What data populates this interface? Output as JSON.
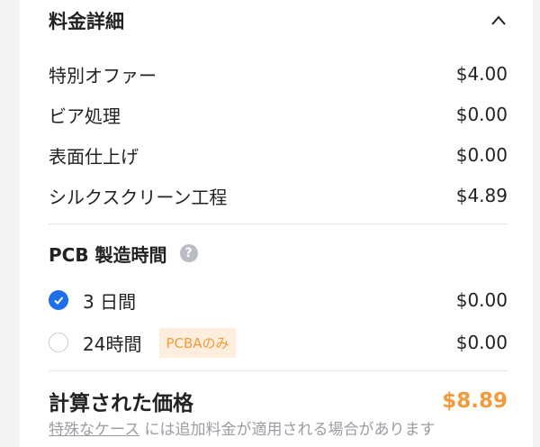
{
  "section": {
    "title": "料金詳細",
    "collapse_icon": "chevron-up-icon"
  },
  "line_items": [
    {
      "label": "特別オファー",
      "price": "$4.00"
    },
    {
      "label": "ビア処理",
      "price": "$0.00"
    },
    {
      "label": "表面仕上げ",
      "price": "$0.00"
    },
    {
      "label": "シルクスクリーン工程",
      "price": "$4.89"
    }
  ],
  "build_time": {
    "title": "PCB 製造時間",
    "help_icon": "question-circle-icon",
    "help_glyph": "?",
    "options": [
      {
        "label": "3 日間",
        "price": "$0.00",
        "selected": true
      },
      {
        "label": "24時間",
        "tag": "PCBAのみ",
        "price": "$0.00",
        "selected": false
      }
    ]
  },
  "total": {
    "label": "計算された価格",
    "price": "$8.89"
  },
  "note": {
    "link": "特殊なケース",
    "text": " には追加料金が適用される場合があります"
  },
  "colors": {
    "accent": "#1f6fea",
    "price_highlight": "#f39a3b",
    "tag_bg": "#fdeedd"
  }
}
